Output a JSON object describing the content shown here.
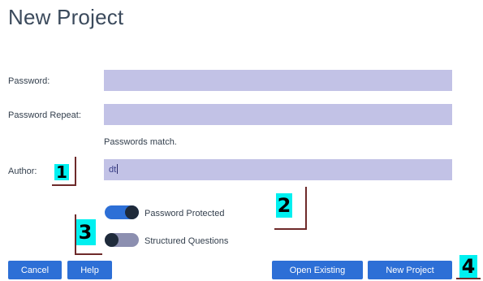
{
  "page": {
    "title": "New Project"
  },
  "form": {
    "password": {
      "label": "Password:",
      "value": ""
    },
    "password_repeat": {
      "label": "Password Repeat:",
      "value": ""
    },
    "match_hint": "Passwords match.",
    "author": {
      "label": "Author:",
      "value": "dt"
    }
  },
  "toggles": {
    "password_protected": {
      "label": "Password Protected",
      "state": "on"
    },
    "structured_questions": {
      "label": "Structured Questions",
      "state": "off"
    }
  },
  "buttons": {
    "cancel": "Cancel",
    "help": "Help",
    "open_existing": "Open Existing",
    "new_project": "New Project"
  },
  "markers": [
    "1",
    "2",
    "3",
    "4"
  ],
  "colors": {
    "accent": "#2d6fd6",
    "field_bg": "#c2c2e6",
    "marker_bg": "#00f0f0",
    "bracket": "#6e2a2a"
  }
}
